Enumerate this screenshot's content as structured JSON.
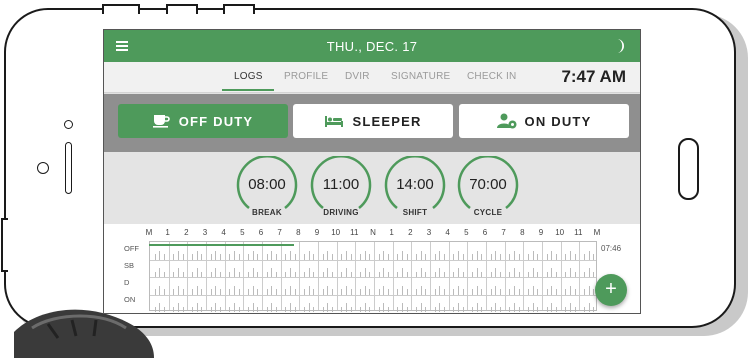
{
  "header": {
    "date": "THU., DEC. 17"
  },
  "tabs": [
    {
      "label": "LOGS",
      "active": true
    },
    {
      "label": "PROFILE",
      "active": false
    },
    {
      "label": "DVIR",
      "active": false
    },
    {
      "label": "SIGNATURE",
      "active": false
    },
    {
      "label": "CHECK IN",
      "active": false
    }
  ],
  "clock": "7:47 AM",
  "status_buttons": [
    {
      "label": "OFF DUTY",
      "icon": "coffee-cup-icon",
      "active": true
    },
    {
      "label": "SLEEPER",
      "icon": "bed-icon",
      "active": false
    },
    {
      "label": "ON DUTY",
      "icon": "driver-icon",
      "active": false
    }
  ],
  "timers": [
    {
      "value": "08:00",
      "label": "BREAK"
    },
    {
      "value": "11:00",
      "label": "DRIVING"
    },
    {
      "value": "14:00",
      "label": "SHIFT"
    },
    {
      "value": "70:00",
      "label": "CYCLE"
    }
  ],
  "grid": {
    "hour_labels": [
      "M",
      "1",
      "2",
      "3",
      "4",
      "5",
      "6",
      "7",
      "8",
      "9",
      "10",
      "11",
      "N",
      "1",
      "2",
      "3",
      "4",
      "5",
      "6",
      "7",
      "8",
      "9",
      "10",
      "11",
      "M"
    ],
    "rows": [
      "OFF",
      "SB",
      "D",
      "ON"
    ],
    "off_duty_hours": 7.75,
    "total_off": "07:46"
  },
  "fab": {
    "label": "+"
  },
  "colors": {
    "accent": "#4e9a5b",
    "status_bg": "#8f8f8f"
  }
}
